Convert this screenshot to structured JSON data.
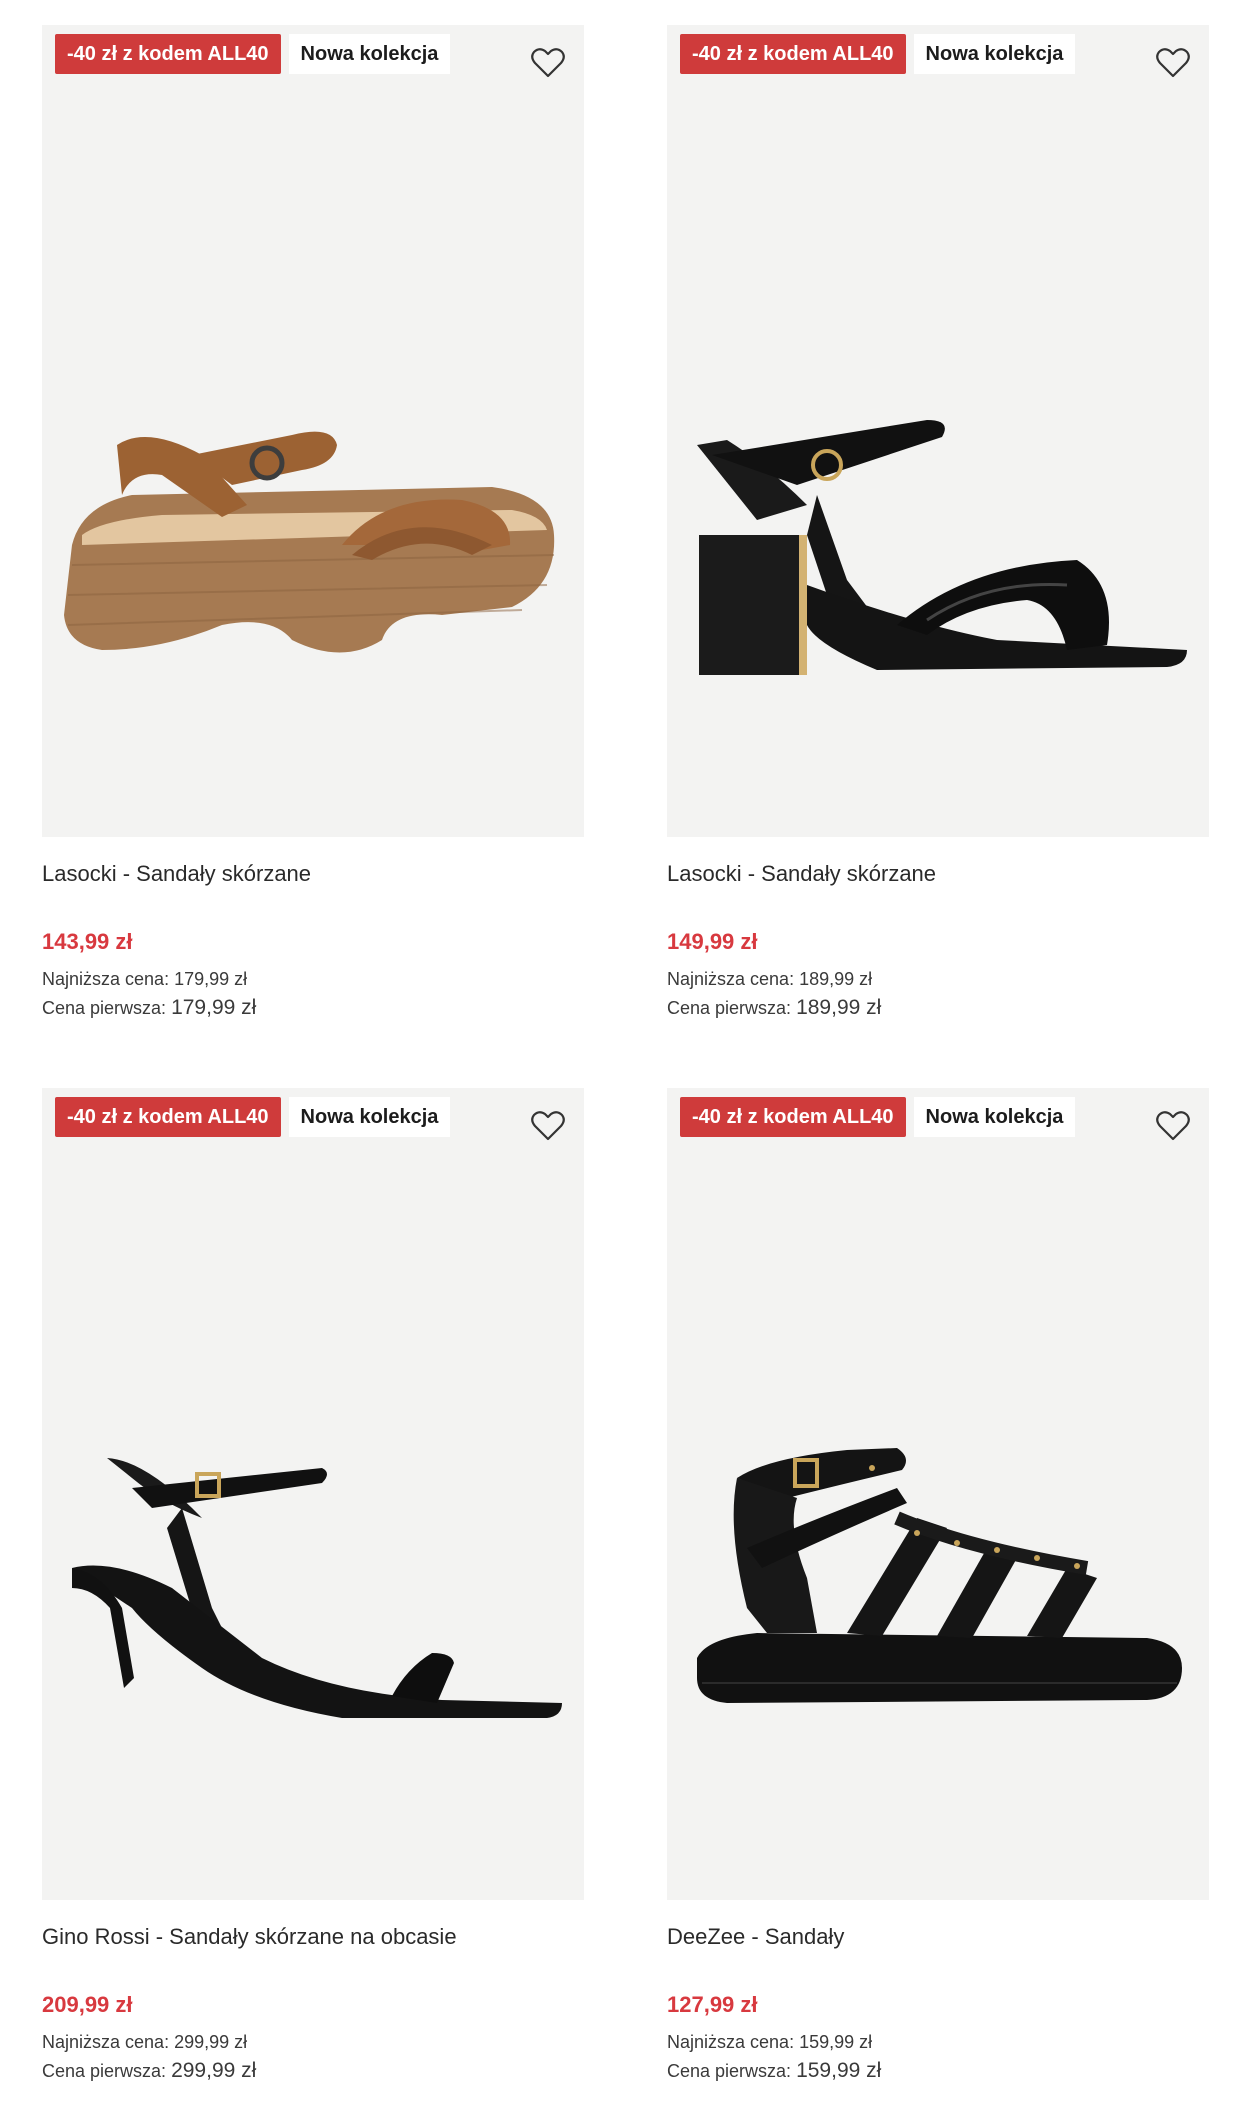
{
  "colors": {
    "promo_badge": "#cf3b3b",
    "price": "#d8393f",
    "image_bg": "#f3f3f2"
  },
  "products": [
    {
      "promo_badge": "-40 zł z kodem ALL40",
      "new_badge": "Nowa kolekcja",
      "favorite_icon": "heart-outline-icon",
      "image": "brown-platform-sandal",
      "name": "Lasocki - Sandały skórzane",
      "price": "143,99 zł",
      "lowest_label": "Najniższa cena:",
      "lowest_price": "179,99 zł",
      "first_label": "Cena pierwsza:",
      "first_price": "179,99 zł"
    },
    {
      "promo_badge": "-40 zł z kodem ALL40",
      "new_badge": "Nowa kolekcja",
      "favorite_icon": "heart-outline-icon",
      "image": "black-block-heel-sandal",
      "name": "Lasocki - Sandały skórzane",
      "price": "149,99 zł",
      "lowest_label": "Najniższa cena:",
      "lowest_price": "189,99 zł",
      "first_label": "Cena pierwsza:",
      "first_price": "189,99 zł"
    },
    {
      "promo_badge": "-40 zł z kodem ALL40",
      "new_badge": "Nowa kolekcja",
      "favorite_icon": "heart-outline-icon",
      "image": "black-stiletto-sandal",
      "name": "Gino Rossi - Sandały skórzane na obcasie",
      "price": "209,99 zł",
      "lowest_label": "Najniższa cena:",
      "lowest_price": "299,99 zł",
      "first_label": "Cena pierwsza:",
      "first_price": "299,99 zł"
    },
    {
      "promo_badge": "-40 zł z kodem ALL40",
      "new_badge": "Nowa kolekcja",
      "favorite_icon": "heart-outline-icon",
      "image": "black-gladiator-platform-sandal",
      "name": "DeeZee - Sandały",
      "price": "127,99 zł",
      "lowest_label": "Najniższa cena:",
      "lowest_price": "159,99 zł",
      "first_label": "Cena pierwsza:",
      "first_price": "159,99 zł"
    }
  ]
}
